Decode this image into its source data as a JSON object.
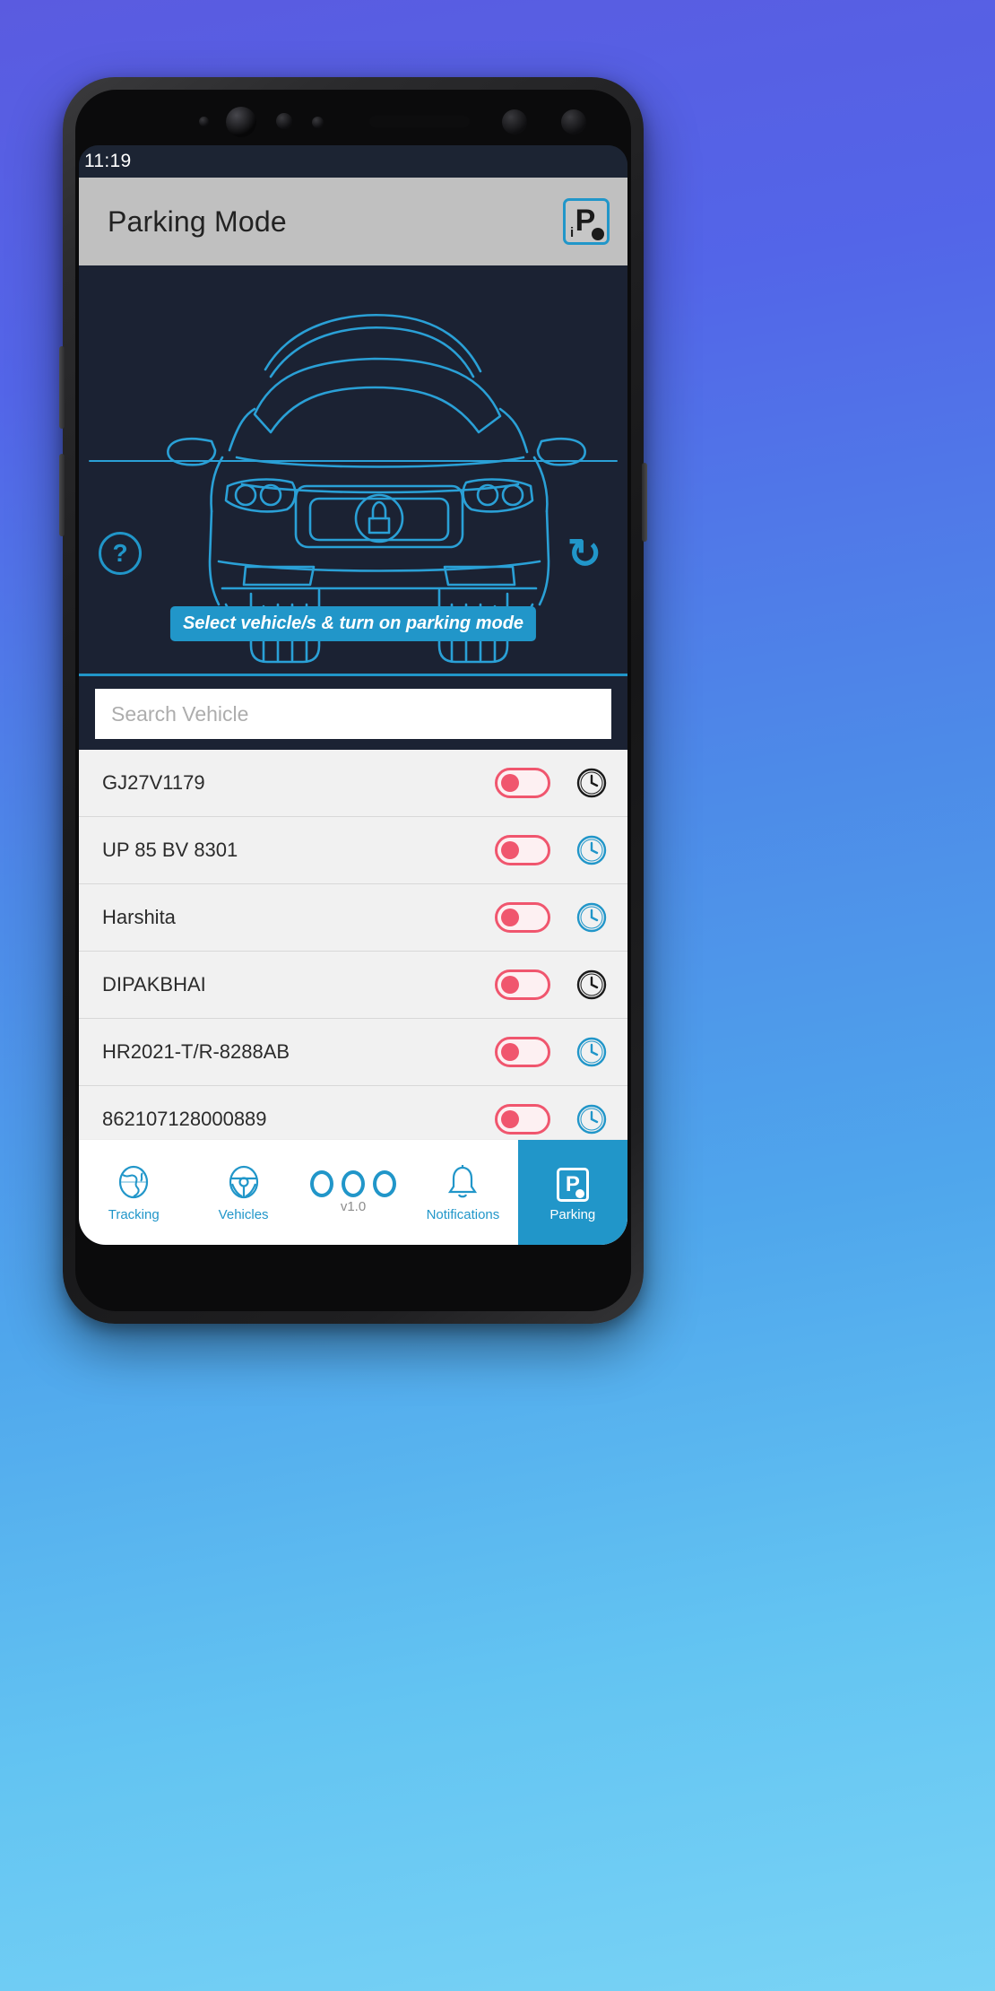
{
  "status_bar": {
    "time": "11:19"
  },
  "app_bar": {
    "title": "Parking Mode",
    "action_icon": "parking-info-icon",
    "action_letter": "P",
    "action_sub": "i"
  },
  "hero": {
    "car_icon": "car-front-outline-icon",
    "lock_icon": "lock-icon",
    "help_icon": "help-question-icon",
    "help_label": "?",
    "refresh_icon": "refresh-icon",
    "refresh_label": "↻",
    "hint": "Select vehicle/s & turn on parking mode"
  },
  "search": {
    "placeholder": "Search Vehicle",
    "value": ""
  },
  "vehicles": [
    {
      "name": "GJ27V1179",
      "toggle_state": "off",
      "schedule_icon": "clock-icon",
      "clock_color": "#1b1b1b"
    },
    {
      "name": "UP 85 BV 8301",
      "toggle_state": "off",
      "schedule_icon": "clock-icon",
      "clock_color": "#2196c9"
    },
    {
      "name": "Harshita",
      "toggle_state": "off",
      "schedule_icon": "clock-icon",
      "clock_color": "#2196c9"
    },
    {
      "name": "DIPAKBHAI",
      "toggle_state": "off",
      "schedule_icon": "clock-icon",
      "clock_color": "#1b1b1b"
    },
    {
      "name": "HR2021-T/R-8288AB",
      "toggle_state": "off",
      "schedule_icon": "clock-icon",
      "clock_color": "#2196c9"
    },
    {
      "name": "862107128000889",
      "toggle_state": "off",
      "schedule_icon": "clock-icon",
      "clock_color": "#2196c9"
    }
  ],
  "bottom_nav": {
    "items": [
      {
        "label": "Tracking",
        "icon": "globe-icon",
        "active": false
      },
      {
        "label": "Vehicles",
        "icon": "steering-wheel-icon",
        "active": false
      },
      {
        "label": "v1.0",
        "icon": "three-circles-icon",
        "active": false
      },
      {
        "label": "Notifications",
        "icon": "bell-icon",
        "active": false
      },
      {
        "label": "Parking",
        "icon": "parking-p-icon",
        "active": true
      }
    ]
  },
  "colors": {
    "accent": "#2196c9",
    "toggle_off": "#f0566e",
    "appbar_bg": "#c0c0c0",
    "hero_bg": "#1b2233",
    "list_bg": "#f1f1f1"
  }
}
